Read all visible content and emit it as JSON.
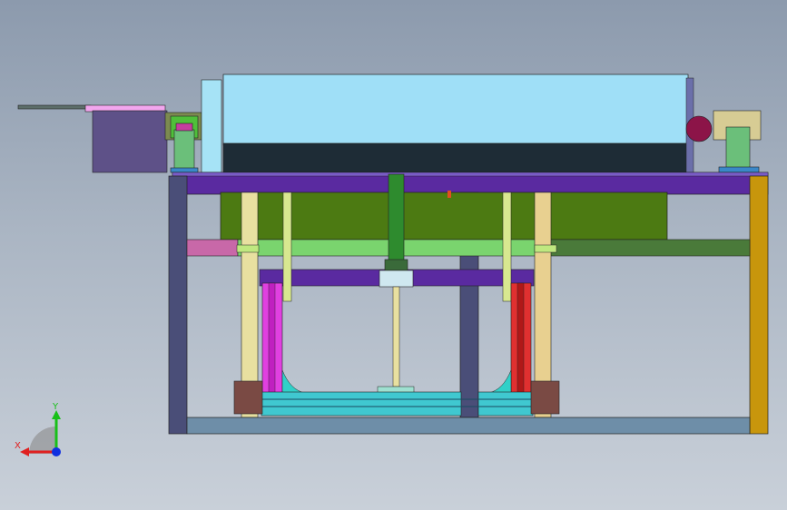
{
  "viewport": {
    "background_top": "#8c9aad",
    "background_bottom": "#c9d0d9"
  },
  "triad": {
    "x_label": "X",
    "y_label": "Y",
    "x_color": "#e02020",
    "y_color": "#18c018",
    "z_color": "#1030e0"
  },
  "colors": {
    "hopper_top": "#9fdff7",
    "hopper_bottom": "#1e2c36",
    "top_beam": "#5a2aa0",
    "mid_plate": "#4c7a12",
    "green_rail": "#7ad46e",
    "right_frame": "#c8960c",
    "left_frame": "#4a4e78",
    "base_beam": "#6e8ea8",
    "pneumatic_cylinder": "#2e8b2e",
    "magenta_block": "#e040e0",
    "red_block": "#e03030",
    "guide_rod": "#e8e0a0",
    "cyan_plate": "#40c8d0",
    "bearing_block": "#7a4a44"
  }
}
